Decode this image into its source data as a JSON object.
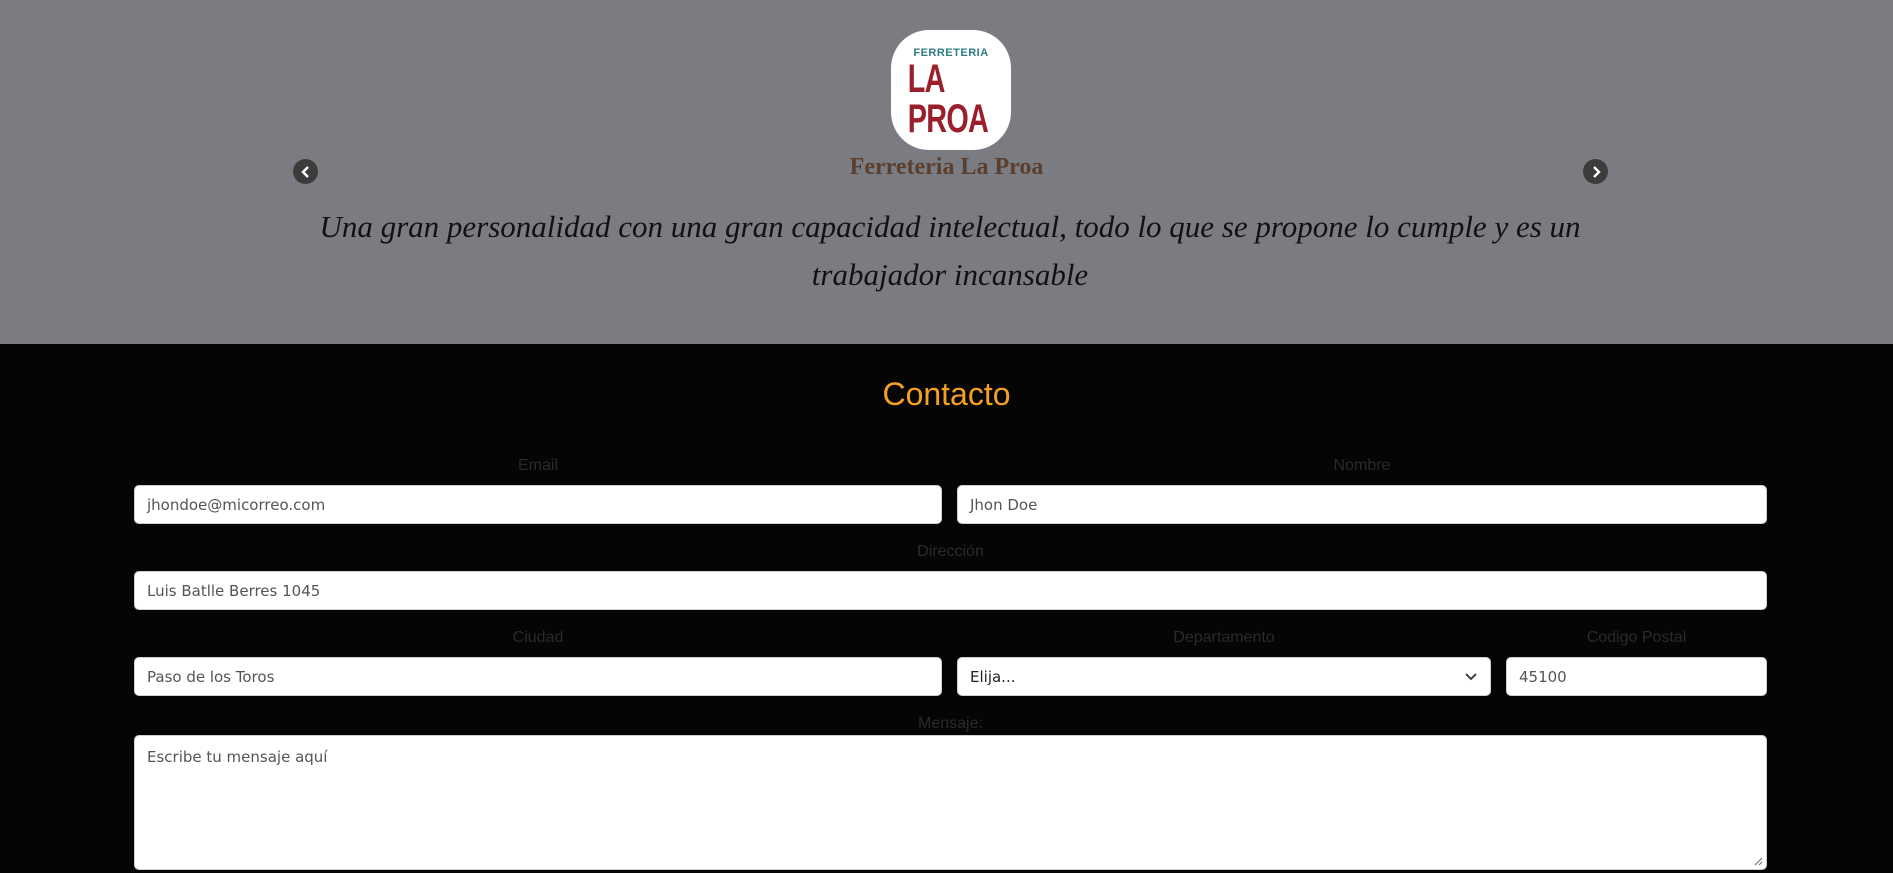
{
  "testimonial": {
    "logo": {
      "top_text": "FERRETERIA",
      "main_text": "LA PROA"
    },
    "company_name": "Ferreteria La Proa",
    "quote": "Una gran personalidad con una gran capacidad intelectual, todo lo que se propone lo cumple y es un trabajador incansable",
    "prev_icon": "chevron-left-icon",
    "next_icon": "chevron-right-icon"
  },
  "contact": {
    "title": "Contacto",
    "email": {
      "label": "Email",
      "placeholder": "jhondoe@micorreo.com"
    },
    "nombre": {
      "label": "Nombre",
      "placeholder": "Jhon Doe"
    },
    "direccion": {
      "label": "Dirección",
      "placeholder": "Luis Batlle Berres 1045"
    },
    "ciudad": {
      "label": "Ciudad",
      "placeholder": "Paso de los Toros"
    },
    "departamento": {
      "label": "Departamento",
      "selected": "Elija..."
    },
    "codigo_postal": {
      "label": "Codigo Postal",
      "placeholder": "45100"
    },
    "mensaje": {
      "label": "Mensaje:",
      "placeholder": "Escribe tu mensaje aquí"
    }
  },
  "colors": {
    "testimonial_bg": "#7b7b82",
    "page_bg": "#050505",
    "accent": "#f5a024",
    "company_name": "#5b3f2c"
  }
}
